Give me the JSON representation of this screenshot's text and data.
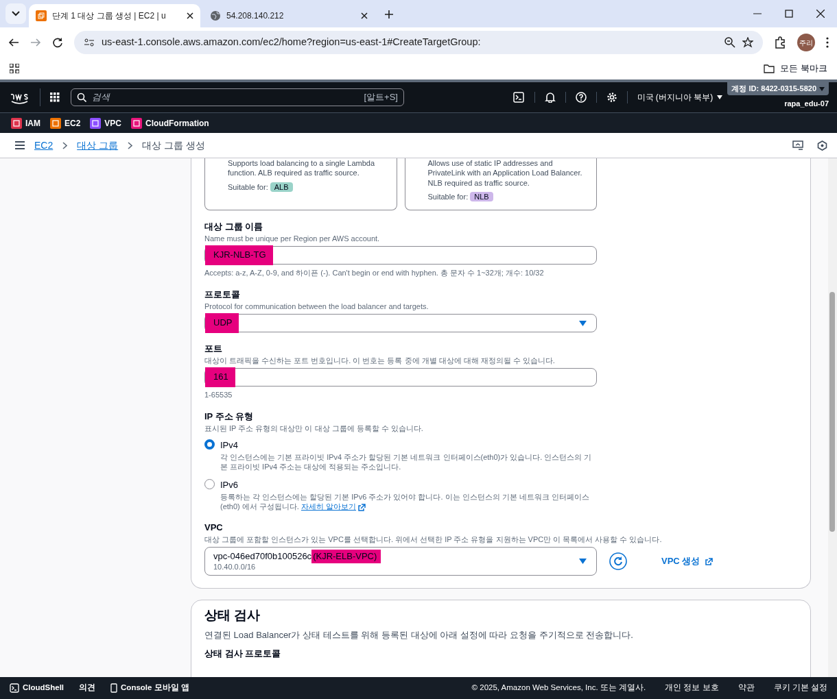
{
  "browser": {
    "tabs": [
      {
        "title": "단계 1 대상 그룹 생성 | EC2 | u",
        "kind": "aws",
        "selected": true
      },
      {
        "title": "54.208.140.212",
        "kind": "globe",
        "selected": false
      }
    ],
    "url": "us-east-1.console.aws.amazon.com/ec2/home?region=us-east-1#CreateTargetGroup:",
    "profile": "주리",
    "bookmarks_label": "모든 북마크"
  },
  "aws_nav": {
    "search_placeholder": "검색",
    "shortcut": "[알트+S]",
    "region": "미국 (버지니아 북부)",
    "account": "계정 ID: 8422-0315-5820",
    "user": "rapa_edu-07"
  },
  "favorites": [
    {
      "label": "IAM",
      "color": "#dd344c"
    },
    {
      "label": "EC2",
      "color": "#ed7100"
    },
    {
      "label": "VPC",
      "color": "#8c4fff"
    },
    {
      "label": "CloudFormation",
      "color": "#e7157b"
    }
  ],
  "breadcrumb": [
    {
      "label": "EC2",
      "link": true
    },
    {
      "label": "대상 그룹",
      "link": true
    },
    {
      "label": "대상 그룹 생성",
      "link": false
    }
  ],
  "type_cards": [
    {
      "lines": [
        "Supports load balancing to a single Lambda",
        "function. ALB required as traffic source."
      ],
      "suitable_label": "Suitable for:",
      "badge": "ALB",
      "color": "#9ad3c9"
    },
    {
      "lines": [
        "Allows use of static IP addresses and",
        "PrivateLink with an Application Load Balancer.",
        "NLB required as traffic source."
      ],
      "suitable_label": "Suitable for:",
      "badge": "NLB",
      "color": "#cdb7ea"
    }
  ],
  "fields": [
    {
      "kind": "input",
      "label": "대상 그룹 이름",
      "description": "Name must be unique per Region per AWS account.",
      "value": "KJR-NLB-TG",
      "highlighted": true,
      "hint": "Accepts: a-z, A-Z, 0-9, and 하이픈 (-). Can't begin or end with hyphen. 총 문자 수 1~32개; 개수: 10/32"
    },
    {
      "kind": "select",
      "label": "프로토콜",
      "description": "Protocol for communication between the load balancer and targets.",
      "value": "UDP",
      "highlighted": true
    },
    {
      "kind": "input",
      "label": "포트",
      "description": "대상이 트래픽을 수신하는 포트 번호입니다. 이 번호는 등록 중에 개별 대상에 대해 재정의될 수 있습니다.",
      "value": "161",
      "highlighted": true,
      "hint": "1-65535"
    }
  ],
  "ip_type": {
    "label": "IP 주소 유형",
    "description": "표시된 IP 주소 유형의 대상만 이 대상 그룹에 등록할 수 있습니다.",
    "options": [
      {
        "label": "IPv4",
        "description": "각 인스턴스에는 기본 프라이빗 IPv4 주소가 할당된 기본 네트워크 인터페이스(eth0)가 있습니다. 인스턴스의 기본 프라이빗 IPv4 주소는 대상에 적용되는 주소입니다.",
        "selected": true
      },
      {
        "label": "IPv6",
        "description": "등록하는 각 인스턴스에는 할당된 기본 IPv6 주소가 있어야 합니다. 이는 인스턴스의 기본 네트워크 인터페이스 (eth0) 에서 구성됩니다.",
        "link": "자세히 알아보기",
        "selected": false
      }
    ]
  },
  "vpc": {
    "label": "VPC",
    "description": "대상 그룹에 포함할 인스턴스가 있는 VPC를 선택합니다. 위에서 선택한 IP 주소 유형을 지원하는 VPC만 이 목록에서 사용할 수 있습니다.",
    "vpc_id": "vpc-046ed70f0b100526c",
    "vpc_name": "(KJR-ELB-VPC)",
    "highlighted": true,
    "cidr": "10.40.0.0/16",
    "create_link": "VPC 생성"
  },
  "health_check": {
    "title": "상태 검사",
    "description": "연결된 Load Balancer가 상태 테스트를 위해 등록된 대상에 아래 설정에 따라 요청을 주기적으로 전송합니다.",
    "field_label": "상태 검사 프로토콜"
  },
  "footer": {
    "left": [
      {
        "label": "CloudShell",
        "kind": "cloudshell"
      },
      {
        "label": "의견",
        "kind": "text"
      },
      {
        "label": "Console 모바일 앱",
        "kind": "mobile"
      }
    ],
    "copyright": "© 2025, Amazon Web Services, Inc. 또는 계열사.",
    "links": [
      "개인 정보 보호",
      "약관",
      "쿠키 기본 설정"
    ]
  }
}
